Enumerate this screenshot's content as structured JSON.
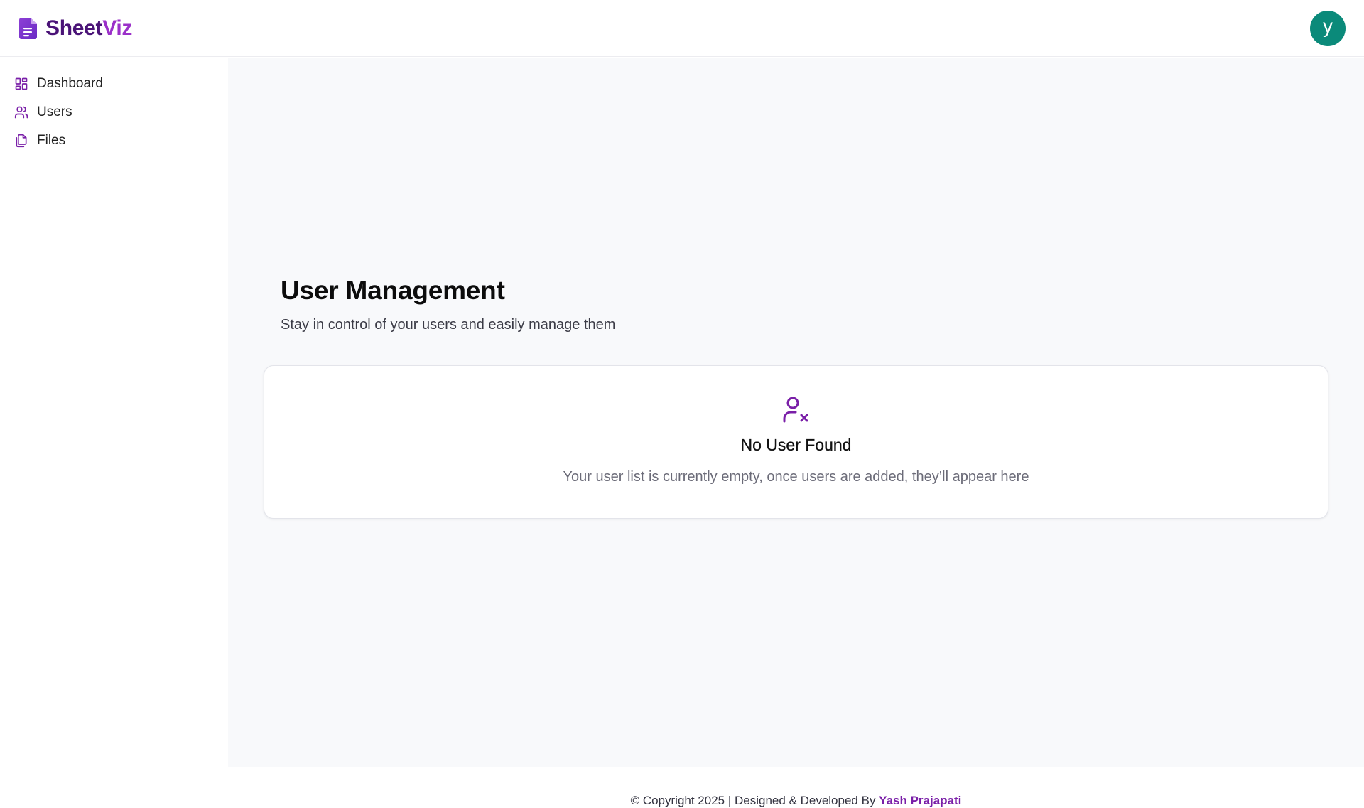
{
  "header": {
    "brand_part1": "Sheet",
    "brand_part2": "Viz",
    "avatar_initial": "y",
    "icons": {
      "logo": "document-icon",
      "avatar": "user-avatar"
    }
  },
  "sidebar": {
    "items": [
      {
        "label": "Dashboard",
        "icon": "dashboard-grid-icon"
      },
      {
        "label": "Users",
        "icon": "users-icon"
      },
      {
        "label": "Files",
        "icon": "files-icon"
      }
    ]
  },
  "main": {
    "title": "User Management",
    "subtitle": "Stay in control of your users and easily manage them",
    "empty_state": {
      "icon": "user-x-icon",
      "title": "No User Found",
      "description": "Your user list is currently empty, once users are added, they’ll appear here"
    }
  },
  "footer": {
    "text": "© Copyright 2025 | Designed & Developed By ",
    "author": "Yash Prajapati"
  },
  "colors": {
    "brand_dark": "#4a1377",
    "brand_light": "#9b30c9",
    "accent": "#7a1fa8",
    "avatar_bg": "#0b8a7a",
    "main_bg": "#f8f9fb"
  }
}
